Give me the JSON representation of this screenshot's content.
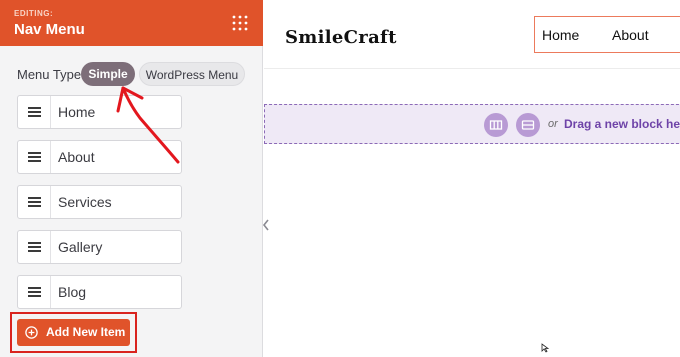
{
  "sidebar": {
    "editing_label": "EDITING:",
    "title": "Nav Menu",
    "menu_type_label": "Menu Type",
    "menu_type_options": [
      "Simple",
      "WordPress Menu"
    ],
    "menu_type_selected": "Simple",
    "items": [
      {
        "label": "Home"
      },
      {
        "label": "About"
      },
      {
        "label": "Services"
      },
      {
        "label": "Gallery"
      },
      {
        "label": "Blog"
      }
    ],
    "add_button_label": "Add New Item"
  },
  "preview": {
    "brand": "SmileCraft",
    "nav_links": [
      "Home",
      "About"
    ],
    "drop_zone": {
      "or_text": "or",
      "drag_text": "Drag a new block here"
    }
  },
  "colors": {
    "accent": "#e0532a",
    "selected_pill": "#7d6e79",
    "drop_zone_bg": "#efe9f6",
    "drop_zone_text": "#6e43a8",
    "highlight": "#d9241f"
  },
  "icons": {
    "header_menu": "grid-dots-icon",
    "drag_handle": "hamburger-icon",
    "add": "plus-circle-icon",
    "collapse": "chevron-left-icon",
    "block_columns": "columns-icon",
    "block_section": "section-icon"
  }
}
